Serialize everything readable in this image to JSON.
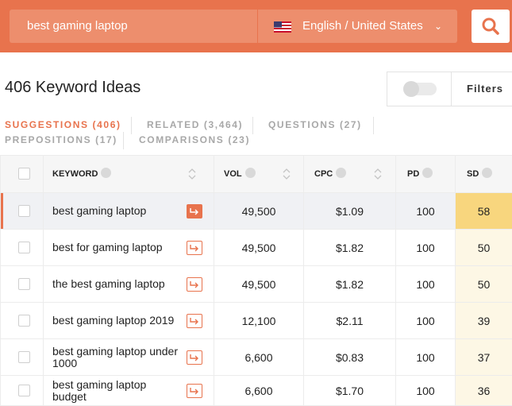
{
  "search": {
    "query": "best gaming laptop",
    "language": "English / United States"
  },
  "header": {
    "title": "406 Keyword Ideas",
    "filters_label": "Filters"
  },
  "tabs": [
    {
      "label": "SUGGESTIONS (406)",
      "active": true
    },
    {
      "label": "RELATED (3,464)",
      "active": false
    },
    {
      "label": "QUESTIONS (27)",
      "active": false
    },
    {
      "label": "PREPOSITIONS (17)",
      "active": false
    },
    {
      "label": "COMPARISONS (23)",
      "active": false
    }
  ],
  "table": {
    "columns": {
      "keyword": "KEYWORD",
      "vol": "VOL",
      "cpc": "CPC",
      "pd": "PD",
      "sd": "SD"
    },
    "rows": [
      {
        "keyword": "best gaming laptop",
        "vol": "49,500",
        "cpc": "$1.09",
        "pd": "100",
        "sd": "58",
        "selected": true
      },
      {
        "keyword": "best for gaming laptop",
        "vol": "49,500",
        "cpc": "$1.82",
        "pd": "100",
        "sd": "50"
      },
      {
        "keyword": "the best gaming laptop",
        "vol": "49,500",
        "cpc": "$1.82",
        "pd": "100",
        "sd": "50"
      },
      {
        "keyword": "best gaming laptop 2019",
        "vol": "12,100",
        "cpc": "$2.11",
        "pd": "100",
        "sd": "39"
      },
      {
        "keyword": "best gaming laptop under 1000",
        "vol": "6,600",
        "cpc": "$0.83",
        "pd": "100",
        "sd": "37"
      },
      {
        "keyword": "best gaming laptop budget",
        "vol": "6,600",
        "cpc": "$1.70",
        "pd": "100",
        "sd": "36"
      }
    ]
  },
  "colors": {
    "accent": "#e8734d",
    "sd_highlight": "#f8d67e",
    "sd_column": "#fdf7e5"
  }
}
